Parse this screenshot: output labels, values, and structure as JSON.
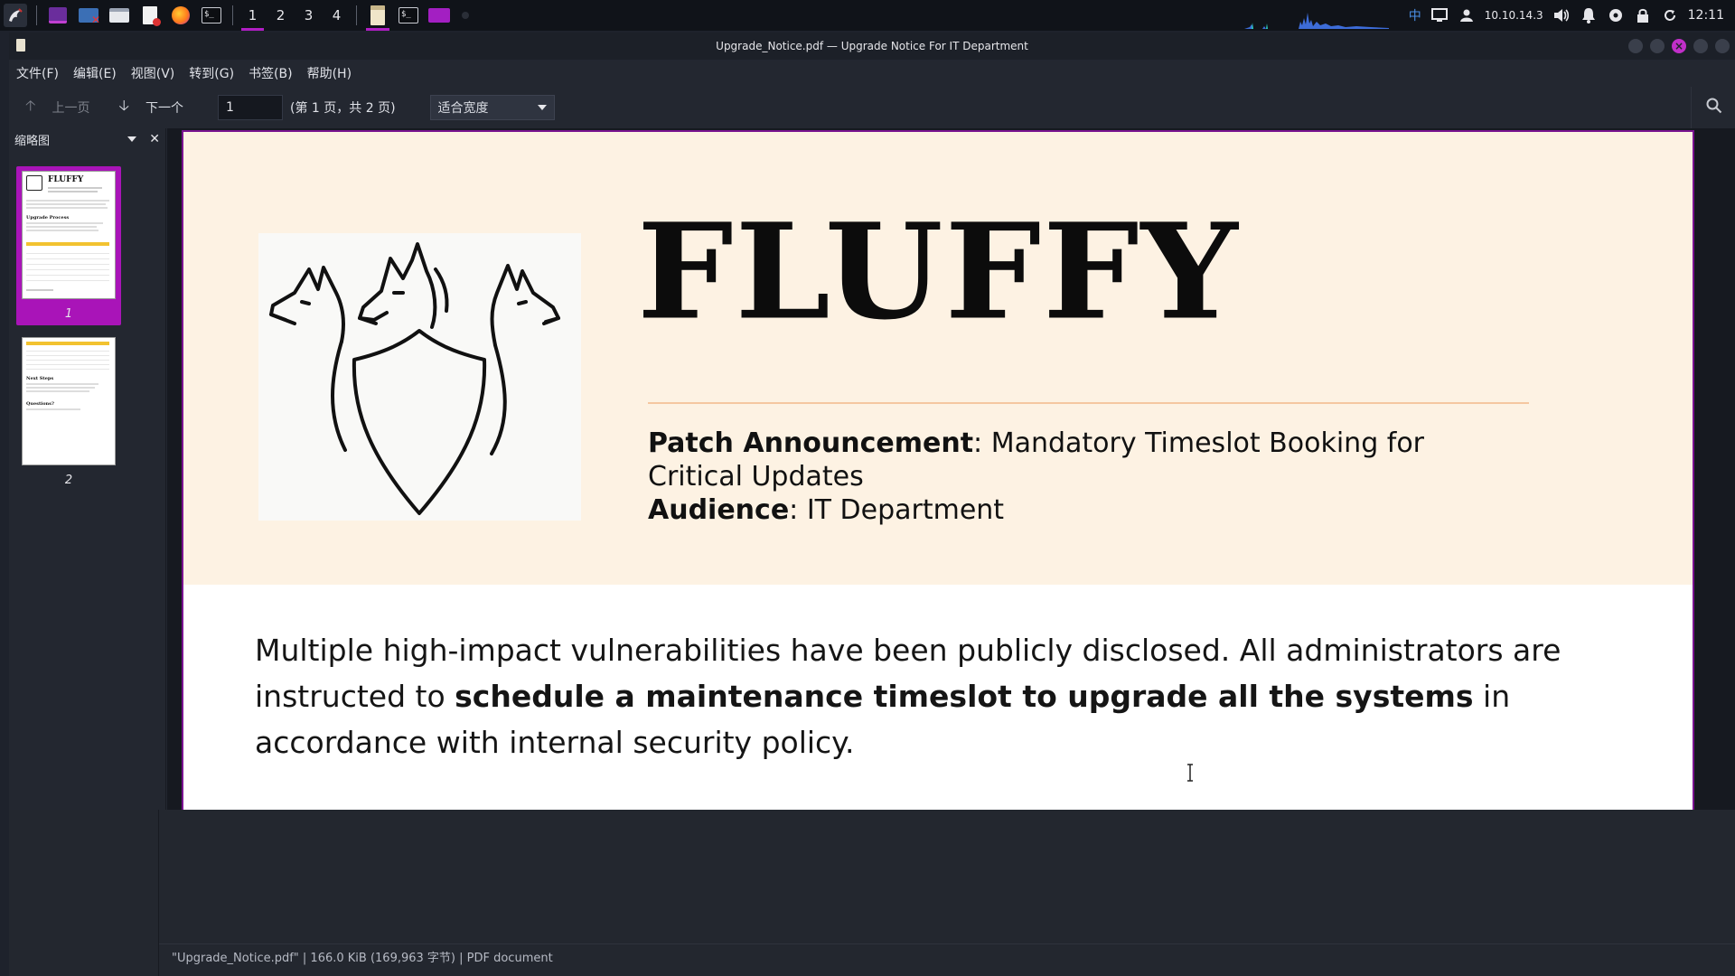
{
  "panel": {
    "workspaces": [
      "1",
      "2",
      "3",
      "4"
    ],
    "active_workspace": "1",
    "tray": {
      "ime": "中",
      "ip": "10.10.14.3",
      "clock": "12:11"
    },
    "icons": [
      "kali-dragon-icon",
      "terminal-purple-icon",
      "window-x-icon",
      "file-manager-icon",
      "document-icon",
      "firefox-icon",
      "terminal-icon",
      "document-viewer-icon",
      "terminal-task-icon",
      "folder-icon"
    ]
  },
  "window": {
    "title": "Upgrade_Notice.pdf — Upgrade Notice For IT Department"
  },
  "menu": {
    "file": "文件(F)",
    "edit": "编辑(E)",
    "view": "视图(V)",
    "go": "转到(G)",
    "bookmarks": "书签(B)",
    "help": "帮助(H)"
  },
  "toolbar": {
    "prev": "上一页",
    "next": "下一个",
    "page_value": "1",
    "page_count": "(第 1 页，共 2 页)",
    "zoom": "适合宽度"
  },
  "sidebar": {
    "title": "缩略图",
    "thumbnails": [
      {
        "label": "1",
        "selected": true
      },
      {
        "label": "2",
        "selected": false
      }
    ],
    "thumb1": {
      "brand": "FLUFFY",
      "heading": "Upgrade Process"
    },
    "thumb2": {
      "heading1": "Next Steps",
      "heading2": "Questions?"
    }
  },
  "document": {
    "brand": "FLUFFY",
    "patch_label": "Patch Announcement",
    "patch_value": ": Mandatory Timeslot Booking for Critical Updates",
    "audience_label": "Audience",
    "audience_value": ": IT Department",
    "para1_part1": "Multiple high-impact vulnerabilities have been publicly disclosed. All administrators are instructed to ",
    "para1_bold": "schedule a maintenance timeslot to upgrade all the systems",
    "para1_part2": " in accordance with internal security policy."
  },
  "status": {
    "text": "\"Upgrade_Notice.pdf\" | 166.0 KiB (169,963 字节) | PDF document"
  },
  "colors": {
    "accent": "#b01ec4",
    "hero_bg": "#fdf2e3",
    "rule": "#f5c7a0",
    "panel_bg": "#101319",
    "window_bg": "#232730"
  }
}
